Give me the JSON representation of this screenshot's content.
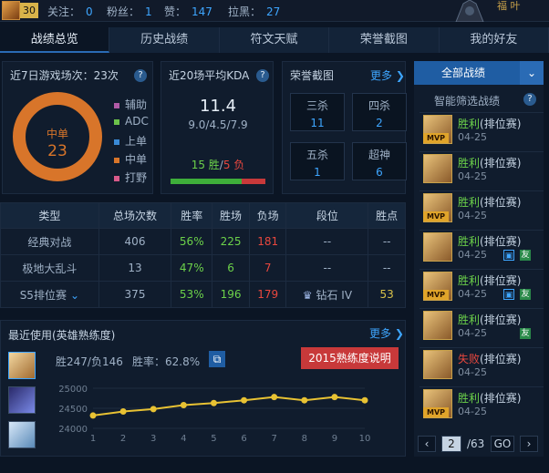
{
  "topbar": {
    "level": "30",
    "follow_label": "关注：",
    "follow_value": "0",
    "fans_label": "粉丝：",
    "fans_value": "1",
    "likes_label": "赞：",
    "likes_value": "147",
    "black_label": "拉黑：",
    "black_value": "27",
    "badge_text": "福 叶"
  },
  "tabs": [
    {
      "label": "战绩总览",
      "active": true
    },
    {
      "label": "历史战绩"
    },
    {
      "label": "符文天赋"
    },
    {
      "label": "荣誉截图"
    },
    {
      "label": "我的好友"
    }
  ],
  "games7": {
    "title": "近7日游戏场次：23次",
    "center_label": "中单",
    "center_value": "23",
    "legend": [
      {
        "label": "辅助",
        "color": "#b05aa6"
      },
      {
        "label": "ADC",
        "color": "#6cc24a"
      },
      {
        "label": "上单",
        "color": "#3a8ad6"
      },
      {
        "label": "中单",
        "color": "#d8752a"
      },
      {
        "label": "打野",
        "color": "#d85a8a"
      }
    ]
  },
  "kda": {
    "title": "近20场平均KDA",
    "value": "11.4",
    "detail": "9.0/4.5/7.9",
    "wins": "15 胜",
    "sep": "/",
    "losses": "5 负",
    "win_fraction": 0.75
  },
  "honor": {
    "title": "荣誉截图",
    "more": "更多",
    "items": [
      {
        "label": "三杀",
        "value": "11"
      },
      {
        "label": "四杀",
        "value": "2"
      },
      {
        "label": "五杀",
        "value": "1"
      },
      {
        "label": "超神",
        "value": "6"
      }
    ]
  },
  "stats": {
    "headers": [
      "类型",
      "总场次数",
      "胜率",
      "胜场",
      "负场",
      "段位",
      "胜点"
    ],
    "rows": [
      {
        "type": "经典对战",
        "total": "406",
        "rate": "56%",
        "win": "225",
        "lose": "181",
        "rank": "--",
        "points": "--"
      },
      {
        "type": "极地大乱斗",
        "total": "13",
        "rate": "47%",
        "win": "6",
        "lose": "7",
        "rank": "--",
        "points": "--"
      },
      {
        "type": "S5排位赛",
        "total": "375",
        "rate": "53%",
        "win": "196",
        "lose": "179",
        "rank": "钻石 IV",
        "points": "53"
      }
    ]
  },
  "recent": {
    "title": "最近使用(英雄熟练度)",
    "more": "更多",
    "record": "胜247/负146",
    "rate": "胜率：62.8%",
    "explain": "2015熟练度说明"
  },
  "chart_data": {
    "type": "line",
    "x": [
      1,
      2,
      3,
      4,
      5,
      6,
      7,
      8,
      9,
      10
    ],
    "values": [
      24320,
      24420,
      24480,
      24580,
      24630,
      24700,
      24780,
      24700,
      24780,
      24700
    ],
    "ylim": [
      24000,
      25000
    ],
    "yticks": [
      24000,
      24500,
      25000
    ],
    "color": "#e8c233"
  },
  "filter": {
    "all_label": "全部战绩",
    "smart_label": "智能筛选战绩"
  },
  "matches": [
    {
      "result": "胜利",
      "mode": "(排位赛)",
      "date": "04-25",
      "win": true,
      "mvp": true,
      "tags": []
    },
    {
      "result": "胜利",
      "mode": "(排位赛)",
      "date": "04-25",
      "win": true,
      "mvp": false,
      "tags": []
    },
    {
      "result": "胜利",
      "mode": "(排位赛)",
      "date": "04-25",
      "win": true,
      "mvp": true,
      "tags": []
    },
    {
      "result": "胜利",
      "mode": "(排位赛)",
      "date": "04-25",
      "win": true,
      "mvp": false,
      "tags": [
        "img",
        "友"
      ]
    },
    {
      "result": "胜利",
      "mode": "(排位赛)",
      "date": "04-25",
      "win": true,
      "mvp": true,
      "tags": [
        "img",
        "友"
      ]
    },
    {
      "result": "胜利",
      "mode": "(排位赛)",
      "date": "04-25",
      "win": true,
      "mvp": false,
      "tags": [
        "友"
      ]
    },
    {
      "result": "失败",
      "mode": "(排位赛)",
      "date": "04-25",
      "win": false,
      "mvp": false,
      "tags": []
    },
    {
      "result": "胜利",
      "mode": "(排位赛)",
      "date": "04-25",
      "win": true,
      "mvp": true,
      "tags": []
    }
  ],
  "pager": {
    "current": "2",
    "total": "/63",
    "go": "GO"
  }
}
